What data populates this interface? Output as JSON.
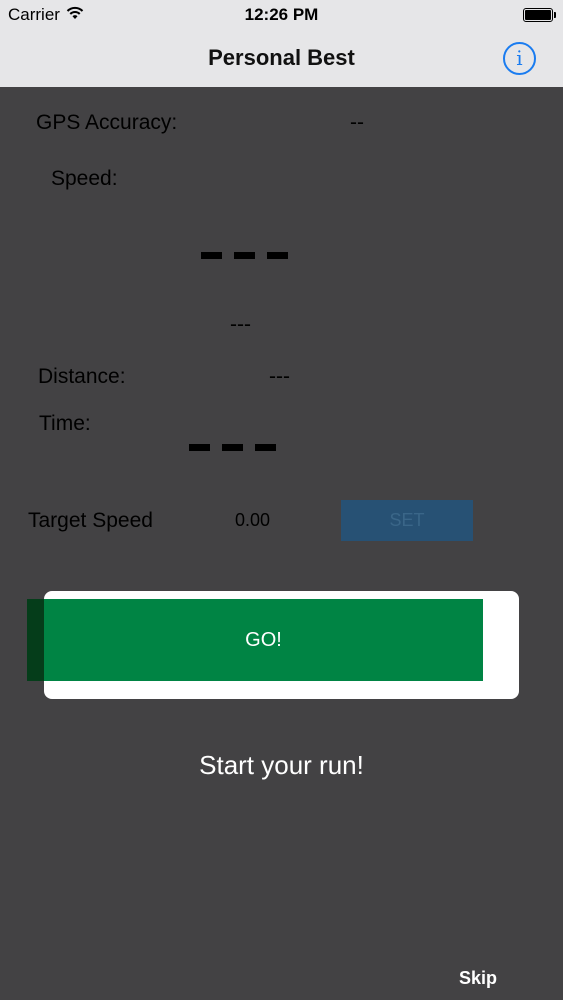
{
  "status_bar": {
    "carrier": "Carrier",
    "time": "12:26 PM"
  },
  "nav": {
    "title": "Personal Best",
    "info_icon": "info-icon",
    "info_glyph": "i"
  },
  "stats": {
    "gps_accuracy_label": "GPS Accuracy:",
    "gps_accuracy_value": "--",
    "speed_label": "Speed:",
    "speed_unit_value": "---",
    "distance_label": "Distance:",
    "distance_value": "---",
    "time_label": "Time:"
  },
  "target": {
    "label": "Target Speed",
    "value": "0.00",
    "set_label": "SET"
  },
  "go_label": "GO!",
  "tip": "Start your run!",
  "skip_label": "Skip",
  "colors": {
    "background": "#434244",
    "bars": "#e6e6e8",
    "go_green": "#008444",
    "set_blue": "#275174",
    "info_blue": "#1a7cf0"
  }
}
